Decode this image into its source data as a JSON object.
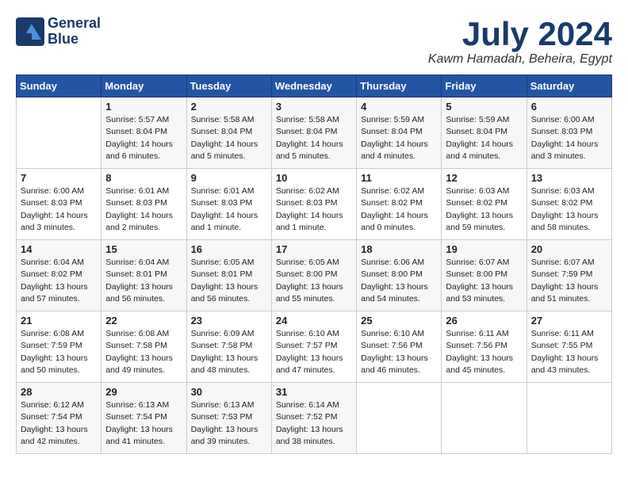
{
  "logo": {
    "line1": "General",
    "line2": "Blue"
  },
  "title": "July 2024",
  "location": "Kawm Hamadah, Beheira, Egypt",
  "days_header": [
    "Sunday",
    "Monday",
    "Tuesday",
    "Wednesday",
    "Thursday",
    "Friday",
    "Saturday"
  ],
  "weeks": [
    [
      {
        "num": "",
        "sunrise": "",
        "sunset": "",
        "daylight": ""
      },
      {
        "num": "1",
        "sunrise": "Sunrise: 5:57 AM",
        "sunset": "Sunset: 8:04 PM",
        "daylight": "Daylight: 14 hours\nand 6 minutes."
      },
      {
        "num": "2",
        "sunrise": "Sunrise: 5:58 AM",
        "sunset": "Sunset: 8:04 PM",
        "daylight": "Daylight: 14 hours\nand 5 minutes."
      },
      {
        "num": "3",
        "sunrise": "Sunrise: 5:58 AM",
        "sunset": "Sunset: 8:04 PM",
        "daylight": "Daylight: 14 hours\nand 5 minutes."
      },
      {
        "num": "4",
        "sunrise": "Sunrise: 5:59 AM",
        "sunset": "Sunset: 8:04 PM",
        "daylight": "Daylight: 14 hours\nand 4 minutes."
      },
      {
        "num": "5",
        "sunrise": "Sunrise: 5:59 AM",
        "sunset": "Sunset: 8:04 PM",
        "daylight": "Daylight: 14 hours\nand 4 minutes."
      },
      {
        "num": "6",
        "sunrise": "Sunrise: 6:00 AM",
        "sunset": "Sunset: 8:03 PM",
        "daylight": "Daylight: 14 hours\nand 3 minutes."
      }
    ],
    [
      {
        "num": "7",
        "sunrise": "Sunrise: 6:00 AM",
        "sunset": "Sunset: 8:03 PM",
        "daylight": "Daylight: 14 hours\nand 3 minutes."
      },
      {
        "num": "8",
        "sunrise": "Sunrise: 6:01 AM",
        "sunset": "Sunset: 8:03 PM",
        "daylight": "Daylight: 14 hours\nand 2 minutes."
      },
      {
        "num": "9",
        "sunrise": "Sunrise: 6:01 AM",
        "sunset": "Sunset: 8:03 PM",
        "daylight": "Daylight: 14 hours\nand 1 minute."
      },
      {
        "num": "10",
        "sunrise": "Sunrise: 6:02 AM",
        "sunset": "Sunset: 8:03 PM",
        "daylight": "Daylight: 14 hours\nand 1 minute."
      },
      {
        "num": "11",
        "sunrise": "Sunrise: 6:02 AM",
        "sunset": "Sunset: 8:02 PM",
        "daylight": "Daylight: 14 hours\nand 0 minutes."
      },
      {
        "num": "12",
        "sunrise": "Sunrise: 6:03 AM",
        "sunset": "Sunset: 8:02 PM",
        "daylight": "Daylight: 13 hours\nand 59 minutes."
      },
      {
        "num": "13",
        "sunrise": "Sunrise: 6:03 AM",
        "sunset": "Sunset: 8:02 PM",
        "daylight": "Daylight: 13 hours\nand 58 minutes."
      }
    ],
    [
      {
        "num": "14",
        "sunrise": "Sunrise: 6:04 AM",
        "sunset": "Sunset: 8:02 PM",
        "daylight": "Daylight: 13 hours\nand 57 minutes."
      },
      {
        "num": "15",
        "sunrise": "Sunrise: 6:04 AM",
        "sunset": "Sunset: 8:01 PM",
        "daylight": "Daylight: 13 hours\nand 56 minutes."
      },
      {
        "num": "16",
        "sunrise": "Sunrise: 6:05 AM",
        "sunset": "Sunset: 8:01 PM",
        "daylight": "Daylight: 13 hours\nand 56 minutes."
      },
      {
        "num": "17",
        "sunrise": "Sunrise: 6:05 AM",
        "sunset": "Sunset: 8:00 PM",
        "daylight": "Daylight: 13 hours\nand 55 minutes."
      },
      {
        "num": "18",
        "sunrise": "Sunrise: 6:06 AM",
        "sunset": "Sunset: 8:00 PM",
        "daylight": "Daylight: 13 hours\nand 54 minutes."
      },
      {
        "num": "19",
        "sunrise": "Sunrise: 6:07 AM",
        "sunset": "Sunset: 8:00 PM",
        "daylight": "Daylight: 13 hours\nand 53 minutes."
      },
      {
        "num": "20",
        "sunrise": "Sunrise: 6:07 AM",
        "sunset": "Sunset: 7:59 PM",
        "daylight": "Daylight: 13 hours\nand 51 minutes."
      }
    ],
    [
      {
        "num": "21",
        "sunrise": "Sunrise: 6:08 AM",
        "sunset": "Sunset: 7:59 PM",
        "daylight": "Daylight: 13 hours\nand 50 minutes."
      },
      {
        "num": "22",
        "sunrise": "Sunrise: 6:08 AM",
        "sunset": "Sunset: 7:58 PM",
        "daylight": "Daylight: 13 hours\nand 49 minutes."
      },
      {
        "num": "23",
        "sunrise": "Sunrise: 6:09 AM",
        "sunset": "Sunset: 7:58 PM",
        "daylight": "Daylight: 13 hours\nand 48 minutes."
      },
      {
        "num": "24",
        "sunrise": "Sunrise: 6:10 AM",
        "sunset": "Sunset: 7:57 PM",
        "daylight": "Daylight: 13 hours\nand 47 minutes."
      },
      {
        "num": "25",
        "sunrise": "Sunrise: 6:10 AM",
        "sunset": "Sunset: 7:56 PM",
        "daylight": "Daylight: 13 hours\nand 46 minutes."
      },
      {
        "num": "26",
        "sunrise": "Sunrise: 6:11 AM",
        "sunset": "Sunset: 7:56 PM",
        "daylight": "Daylight: 13 hours\nand 45 minutes."
      },
      {
        "num": "27",
        "sunrise": "Sunrise: 6:11 AM",
        "sunset": "Sunset: 7:55 PM",
        "daylight": "Daylight: 13 hours\nand 43 minutes."
      }
    ],
    [
      {
        "num": "28",
        "sunrise": "Sunrise: 6:12 AM",
        "sunset": "Sunset: 7:54 PM",
        "daylight": "Daylight: 13 hours\nand 42 minutes."
      },
      {
        "num": "29",
        "sunrise": "Sunrise: 6:13 AM",
        "sunset": "Sunset: 7:54 PM",
        "daylight": "Daylight: 13 hours\nand 41 minutes."
      },
      {
        "num": "30",
        "sunrise": "Sunrise: 6:13 AM",
        "sunset": "Sunset: 7:53 PM",
        "daylight": "Daylight: 13 hours\nand 39 minutes."
      },
      {
        "num": "31",
        "sunrise": "Sunrise: 6:14 AM",
        "sunset": "Sunset: 7:52 PM",
        "daylight": "Daylight: 13 hours\nand 38 minutes."
      },
      {
        "num": "",
        "sunrise": "",
        "sunset": "",
        "daylight": ""
      },
      {
        "num": "",
        "sunrise": "",
        "sunset": "",
        "daylight": ""
      },
      {
        "num": "",
        "sunrise": "",
        "sunset": "",
        "daylight": ""
      }
    ]
  ]
}
